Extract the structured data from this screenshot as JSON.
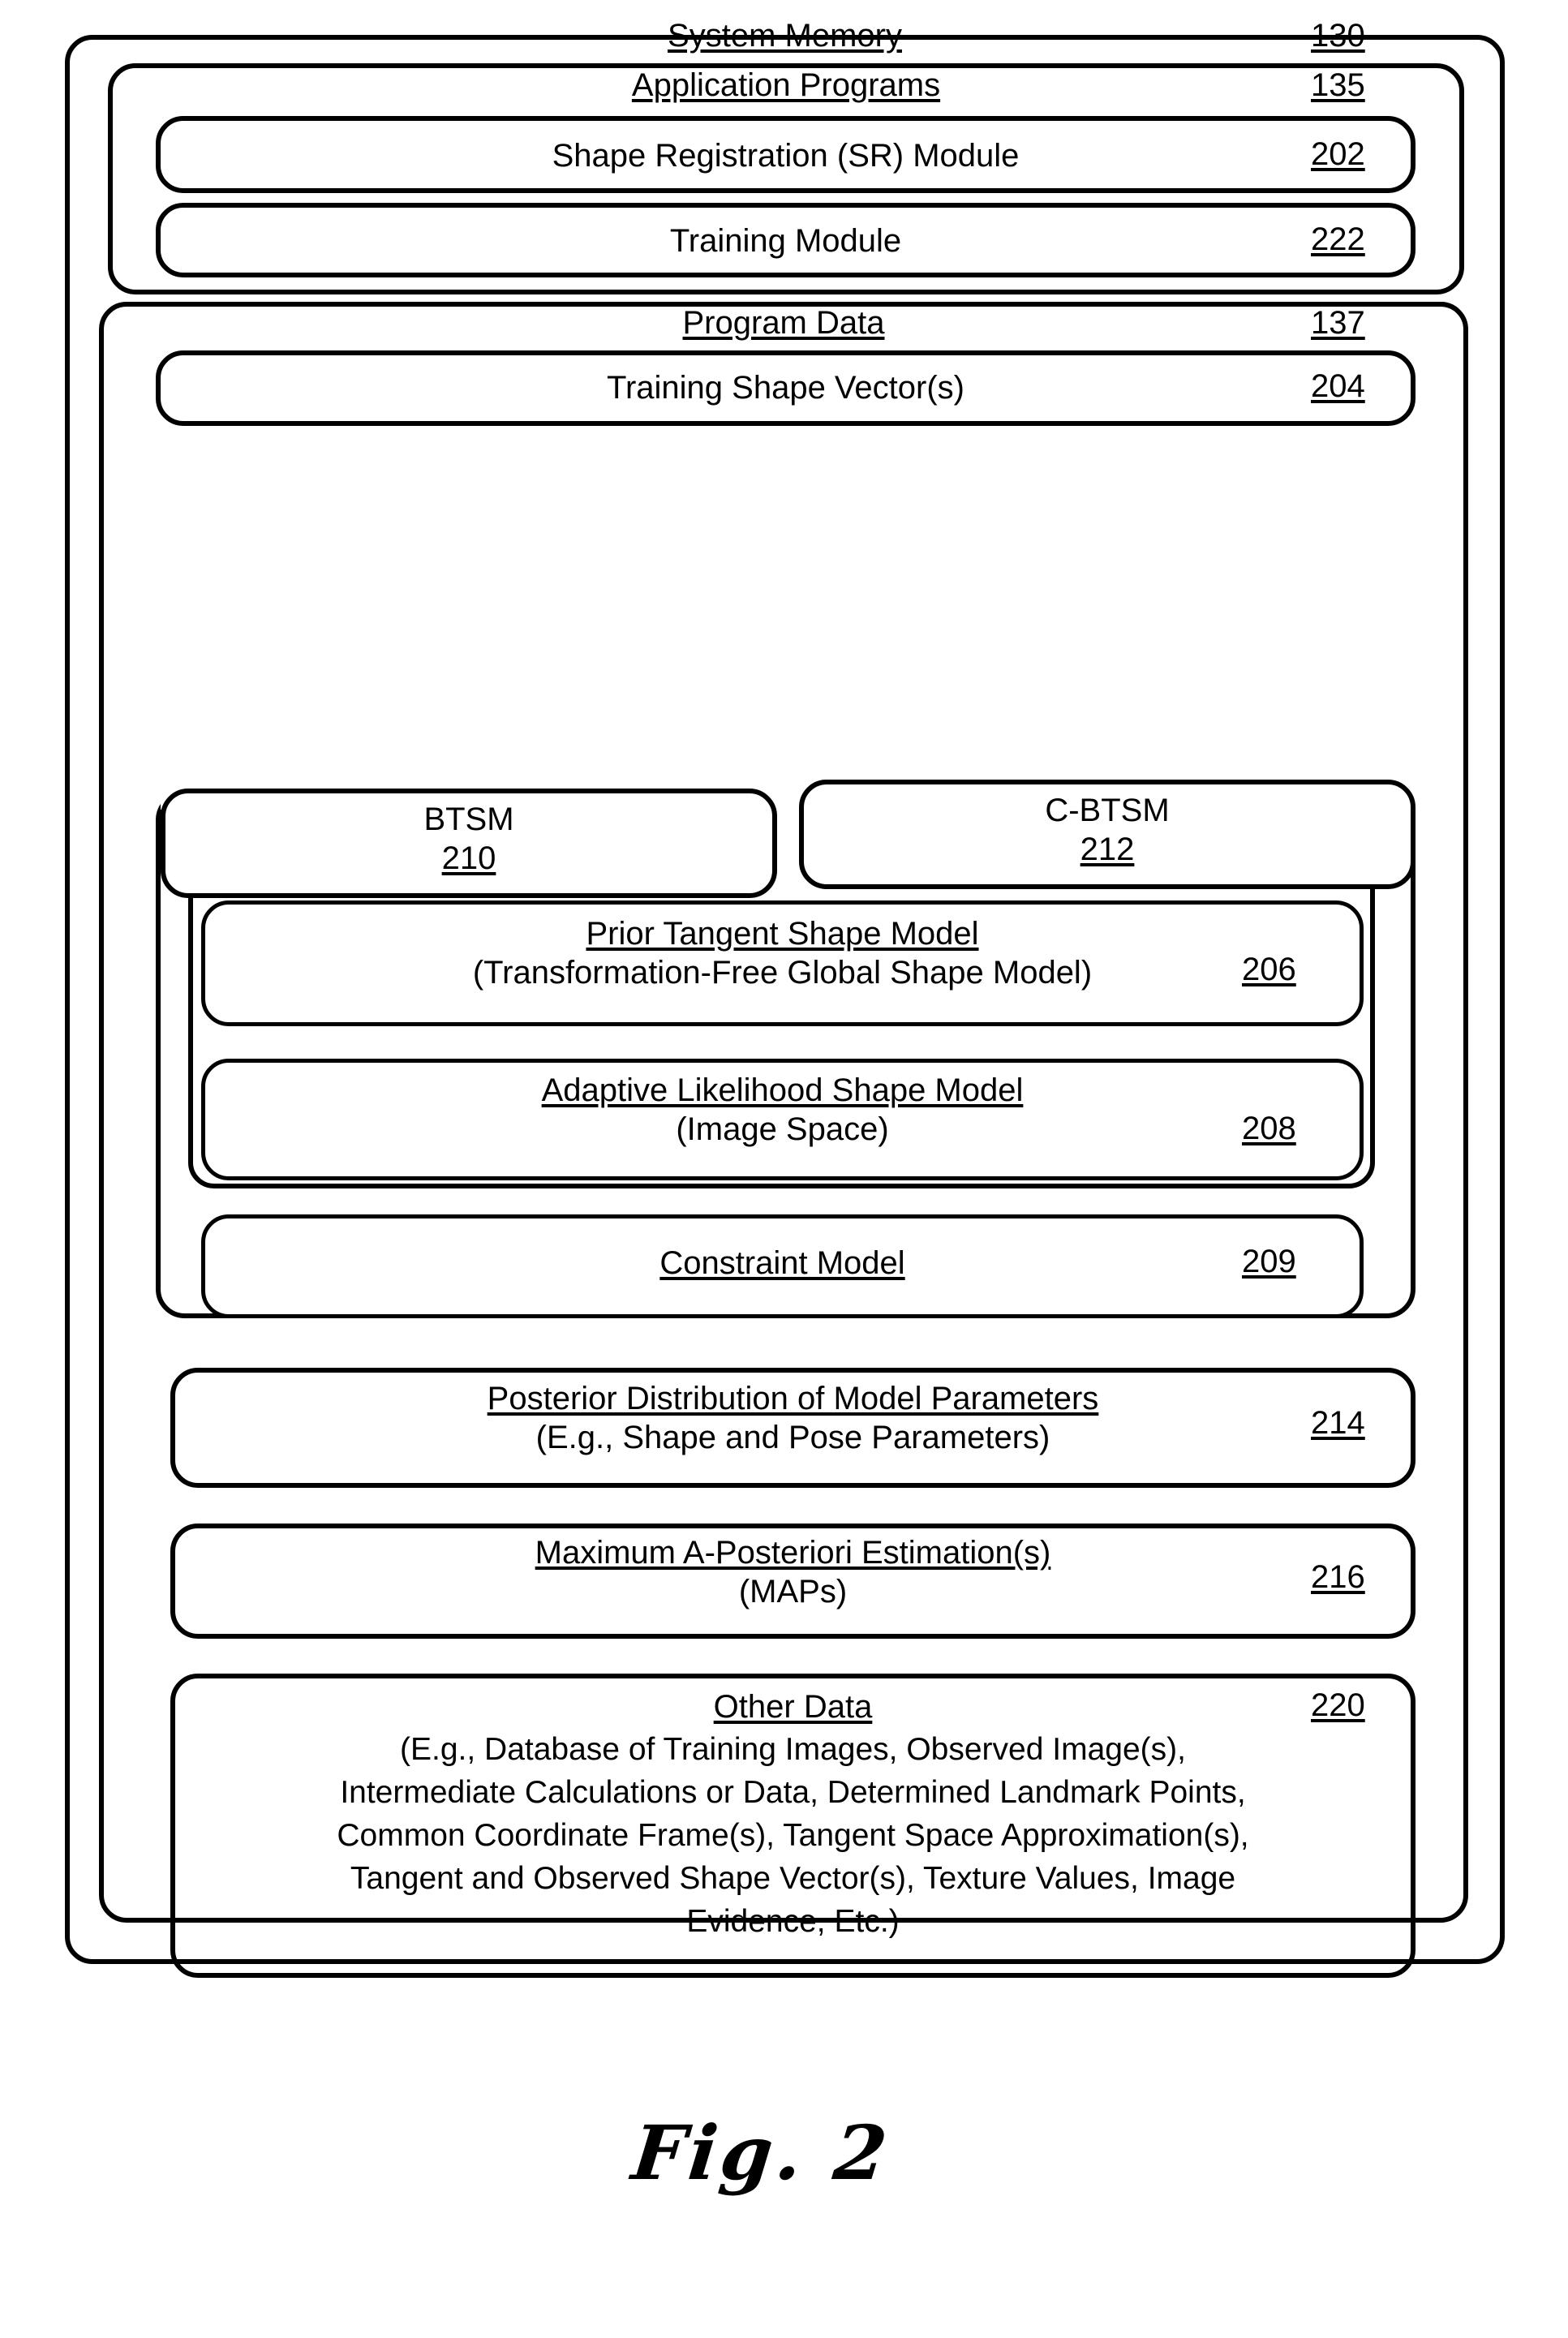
{
  "figure": {
    "caption": "Fig. 2"
  },
  "system_memory": {
    "title": "System Memory",
    "ref": "130"
  },
  "application_programs": {
    "title": "Application Programs",
    "ref": "135",
    "modules": [
      {
        "label": "Shape Registration (SR) Module",
        "ref": "202"
      },
      {
        "label": "Training Module",
        "ref": "222"
      }
    ]
  },
  "program_data": {
    "title": "Program Data",
    "ref": "137",
    "training_shape_vectors": {
      "label": "Training Shape Vector(s)",
      "ref": "204"
    },
    "model_group": {
      "tabs": [
        {
          "label": "BTSM",
          "ref": "210"
        },
        {
          "label": "C-BTSM",
          "ref": "212"
        }
      ],
      "models": [
        {
          "title": "Prior Tangent Shape Model",
          "subtitle": "(Transformation-Free Global Shape Model)",
          "ref": "206"
        },
        {
          "title": "Adaptive Likelihood Shape Model",
          "subtitle": "(Image Space)",
          "ref": "208"
        },
        {
          "title": "Constraint Model",
          "subtitle": "",
          "ref": "209"
        }
      ]
    },
    "posterior": {
      "title": "Posterior Distribution of Model Parameters",
      "subtitle": "(E.g., Shape and Pose Parameters)",
      "ref": "214"
    },
    "map": {
      "title": "Maximum A-Posteriori Estimation(s)",
      "subtitle": "(MAPs)",
      "ref": "216"
    },
    "other_data": {
      "title": "Other Data",
      "ref": "220",
      "lines": [
        "(E.g., Database of Training Images, Observed Image(s),",
        "Intermediate Calculations or Data, Determined Landmark Points,",
        "Common Coordinate Frame(s), Tangent Space Approximation(s),",
        "Tangent and Observed Shape Vector(s), Texture Values, Image",
        "Evidence, Etc.)"
      ]
    }
  }
}
